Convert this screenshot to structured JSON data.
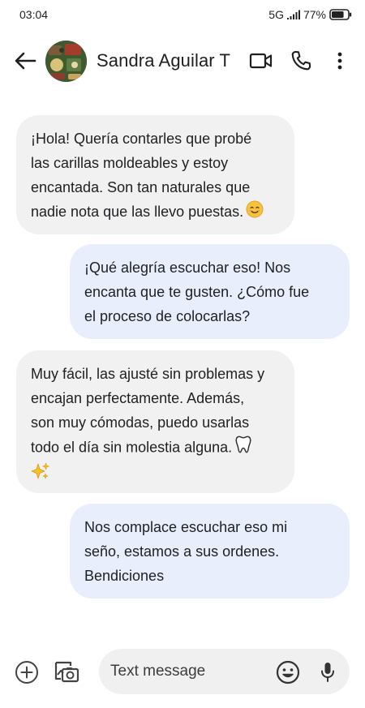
{
  "status_bar": {
    "time": "03:04",
    "network": "5G",
    "battery": "77%",
    "battery_level": 0.77,
    "signal_icon": "signal-bars-icon",
    "battery_icon": "battery-icon"
  },
  "header": {
    "contact_name": "Sandra Aguilar T",
    "back_icon": "arrow-back-icon",
    "video_icon": "video-call-icon",
    "call_icon": "phone-icon",
    "more_icon": "more-vert-icon"
  },
  "messages": [
    {
      "direction": "incoming",
      "lines": [
        "¡Hola! Quería contarles que probé",
        "las carillas moldeables y estoy",
        "encantada. Son tan naturales que",
        "nadie nota que las llevo puestas."
      ],
      "emoji": "smiling-face-emoji"
    },
    {
      "direction": "outgoing",
      "lines": [
        "¡Qué alegría escuchar eso! Nos",
        "encanta que te gusten. ¿Cómo fue",
        "el proceso de colocarlas?"
      ]
    },
    {
      "direction": "incoming",
      "lines": [
        "Muy fácil, las ajusté sin problemas y",
        "encajan perfectamente. Además,",
        "son muy cómodas, puedo usarlas",
        "todo el día sin molestia alguna."
      ],
      "emoji": "tooth-emoji",
      "emoji_2": "sparkles-emoji"
    },
    {
      "direction": "outgoing",
      "lines": [
        "Nos complace escuchar eso mi",
        "seño, estamos a sus ordenes.",
        "Bendiciones"
      ]
    }
  ],
  "composer": {
    "placeholder": "Text message",
    "value": "",
    "add_icon": "add-circle-icon",
    "gallery_icon": "gallery-icon",
    "emoji_icon": "emoji-icon",
    "mic_icon": "mic-icon"
  },
  "colors": {
    "incoming_bubble": "#f1f1f1",
    "outgoing_bubble": "#e8eefc",
    "input_background": "#f0f0f0"
  }
}
